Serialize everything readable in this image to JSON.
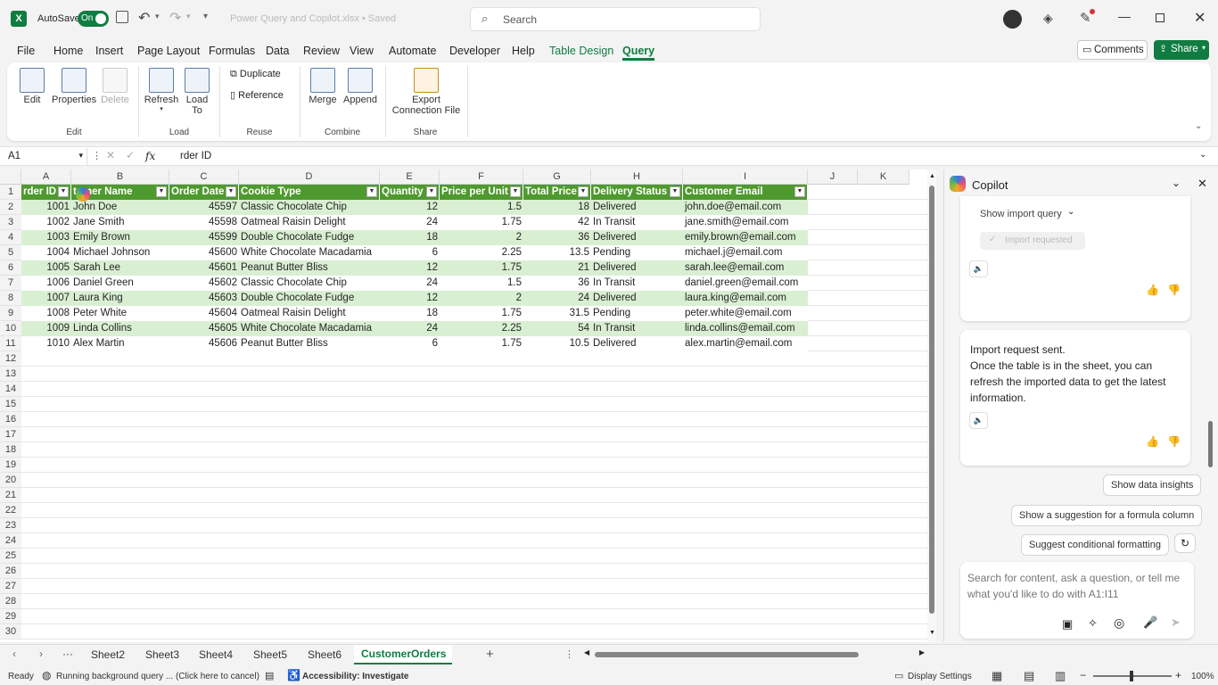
{
  "titlebar": {
    "autosave_label": "AutoSave",
    "toggle_label": "On",
    "file_name": "Power Query and Copilot.xlsx • Saved",
    "search_placeholder": "Search"
  },
  "menu": [
    "File",
    "Home",
    "Insert",
    "Page Layout",
    "Formulas",
    "Data",
    "Review",
    "View",
    "Automate",
    "Developer",
    "Help",
    "Table Design",
    "Query"
  ],
  "menu_actions": {
    "comments": "Comments",
    "share": "Share"
  },
  "ribbon": {
    "buttons": [
      {
        "label": "Edit"
      },
      {
        "label": "Properties"
      },
      {
        "label": "Delete"
      },
      {
        "label": "Refresh"
      },
      {
        "label": "Load To"
      },
      {
        "label": "Merge"
      },
      {
        "label": "Append"
      },
      {
        "label": "Export Connection File"
      }
    ],
    "small": {
      "duplicate": "Duplicate",
      "reference": "Reference"
    },
    "groups": [
      "Edit",
      "Load",
      "Reuse",
      "Combine",
      "Share"
    ]
  },
  "formula": {
    "name_box": "A1",
    "fx": "fx",
    "content": "rder ID"
  },
  "columns": [
    "A",
    "B",
    "C",
    "D",
    "E",
    "F",
    "G",
    "H",
    "I",
    "J",
    "K"
  ],
  "table": {
    "headers": [
      "rder ID",
      "tomer Name",
      "Order Date",
      "Cookie Type",
      "Quantity",
      "Price per Unit",
      "Total Price",
      "Delivery Status",
      "Customer Email"
    ],
    "rows": [
      [
        "1001",
        "John Doe",
        "45597",
        "Classic Chocolate Chip",
        "12",
        "1.5",
        "18",
        "Delivered",
        "john.doe@email.com"
      ],
      [
        "1002",
        "Jane Smith",
        "45598",
        "Oatmeal Raisin Delight",
        "24",
        "1.75",
        "42",
        "In Transit",
        "jane.smith@email.com"
      ],
      [
        "1003",
        "Emily Brown",
        "45599",
        "Double Chocolate Fudge",
        "18",
        "2",
        "36",
        "Delivered",
        "emily.brown@email.com"
      ],
      [
        "1004",
        "Michael Johnson",
        "45600",
        "White Chocolate Macadamia",
        "6",
        "2.25",
        "13.5",
        "Pending",
        "michael.j@email.com"
      ],
      [
        "1005",
        "Sarah Lee",
        "45601",
        "Peanut Butter Bliss",
        "12",
        "1.75",
        "21",
        "Delivered",
        "sarah.lee@email.com"
      ],
      [
        "1006",
        "Daniel Green",
        "45602",
        "Classic Chocolate Chip",
        "24",
        "1.5",
        "36",
        "In Transit",
        "daniel.green@email.com"
      ],
      [
        "1007",
        "Laura King",
        "45603",
        "Double Chocolate Fudge",
        "12",
        "2",
        "24",
        "Delivered",
        "laura.king@email.com"
      ],
      [
        "1008",
        "Peter White",
        "45604",
        "Oatmeal Raisin Delight",
        "18",
        "1.75",
        "31.5",
        "Pending",
        "peter.white@email.com"
      ],
      [
        "1009",
        "Linda Collins",
        "45605",
        "White Chocolate Macadamia",
        "24",
        "2.25",
        "54",
        "In Transit",
        "linda.collins@email.com"
      ],
      [
        "1010",
        "Alex Martin",
        "45606",
        "Peanut Butter Bliss",
        "6",
        "1.75",
        "10.5",
        "Delivered",
        "alex.martin@email.com"
      ]
    ]
  },
  "row_numbers": [
    "1",
    "2",
    "3",
    "4",
    "5",
    "6",
    "7",
    "8",
    "9",
    "10",
    "11",
    "12",
    "13",
    "14",
    "15",
    "16",
    "17",
    "18",
    "19",
    "20",
    "21",
    "22",
    "23",
    "24",
    "25",
    "26",
    "27",
    "28",
    "29",
    "30"
  ],
  "copilot": {
    "title": "Copilot",
    "show_import_query": "Show import query",
    "import_requested": "Import requested",
    "message_lines": [
      "Import request sent.",
      "Once the table is in the sheet, you can",
      "refresh the imported data to get the latest",
      "information."
    ],
    "suggestions": [
      "Show data insights",
      "Show a suggestion for a formula column",
      "Suggest conditional formatting"
    ],
    "input_placeholder": "Search for content, ask a question, or tell me what you'd like to do with A1:I11"
  },
  "sheets": [
    "Sheet2",
    "Sheet3",
    "Sheet4",
    "Sheet5",
    "Sheet6",
    "CustomerOrders"
  ],
  "status": {
    "ready": "Ready",
    "bg_query": "Running background query ... (Click here to cancel)",
    "accessibility": "Accessibility: Investigate",
    "display_settings": "Display Settings",
    "zoom": "100%"
  },
  "colors": {
    "table_header": "#4e9a2e",
    "band": "#d9efd2",
    "excel_green": "#107c41",
    "accent": "#0f6cbd"
  }
}
